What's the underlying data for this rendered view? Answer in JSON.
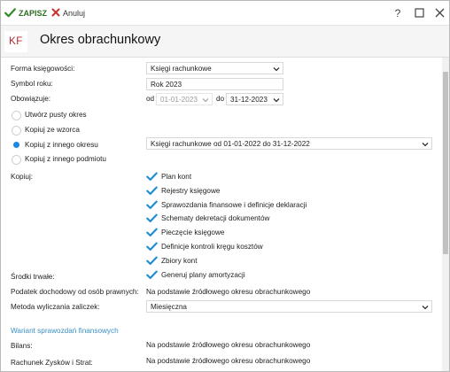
{
  "toolbar": {
    "save_label": "ZAPISZ",
    "cancel_label": "Anuluj",
    "help_label": "?",
    "icons": [
      "check-icon",
      "cross-icon",
      "question-icon",
      "maximize-icon",
      "close-icon"
    ]
  },
  "header": {
    "badge": "KF",
    "title": "Okres obrachunkowy",
    "badge_color": "#b3242c"
  },
  "colors": {
    "save": "#2f6e1f",
    "cancel_x": "#c9302c",
    "check": "#1b8ad3",
    "radio": "#1e88e5",
    "section_link": "#3a8fc6"
  },
  "form": {
    "forma": {
      "label": "Forma księgowości:",
      "value": "Księgi rachunkowe"
    },
    "symbol": {
      "label": "Symbol roku:",
      "value": "Rok 2023"
    },
    "obowiazuje": {
      "label": "Obowiązuje:",
      "from_label": "od",
      "from_value": "01-01-2023",
      "to_label": "do",
      "to_value": "31-12-2023"
    },
    "radios": [
      {
        "label": "Utwórz pusty okres",
        "checked": false
      },
      {
        "label": "Kopiuj ze wzorca",
        "checked": false
      },
      {
        "label": "Kopiuj z innego okresu",
        "checked": true
      },
      {
        "label": "Kopiuj z innego podmiotu",
        "checked": false
      }
    ],
    "copy_source": "Księgi rachunkowe od 01-01-2022 do 31-12-2022",
    "kopiuj": {
      "label": "Kopiuj:",
      "items": [
        {
          "label": "Plan kont",
          "checked": true
        },
        {
          "label": "Rejestry księgowe",
          "checked": true
        },
        {
          "label": "Sprawozdania finansowe i definicje deklaracji",
          "checked": true
        },
        {
          "label": "Schematy dekretacji dokumentów",
          "checked": true
        },
        {
          "label": "Pieczęcie księgowe",
          "checked": true
        },
        {
          "label": "Definicje kontroli kręgu kosztów",
          "checked": true
        },
        {
          "label": "Zbiory kont",
          "checked": true
        }
      ]
    },
    "srodki": {
      "label": "Środki trwałe:",
      "option": "Generuj plany amortyzacji",
      "checked": true
    },
    "podatek": {
      "label": "Podatek dochodowy od osób prawnych:",
      "value": "Na podstawie źródłowego okresu obrachunkowego"
    },
    "metoda": {
      "label": "Metoda wyliczania zaliczek:",
      "value": "Miesięczna"
    },
    "wariant": {
      "title": "Wariant sprawozdań finansowych"
    },
    "bilans": {
      "label": "Bilans:",
      "value": "Na podstawie źródłowego okresu obrachunkowego"
    },
    "rzis": {
      "label": "Rachunek Zysków i Strat:",
      "value": "Na podstawie źródłowego okresu obrachunkowego"
    }
  }
}
